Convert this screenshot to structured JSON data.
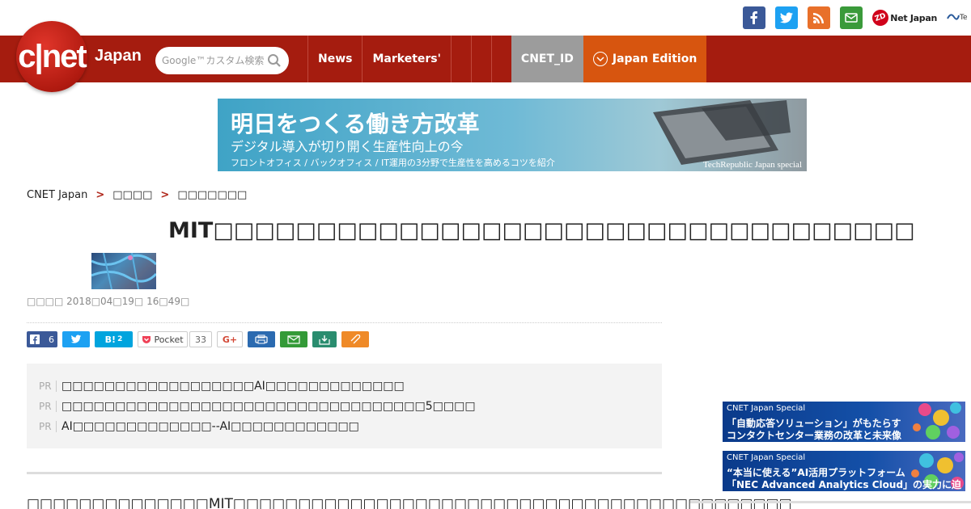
{
  "social": {
    "zdnet": "Net Japan",
    "zdnet_badge": "ZD",
    "techrepublic": "Te"
  },
  "header": {
    "logo_text": "c|net",
    "logo_sub": "Japan",
    "search_placeholder": "Google™カスタム検索",
    "nav": [
      "News",
      "Marketers'"
    ],
    "cnet_id": "CNET_ID",
    "edition": "Japan Edition"
  },
  "banner": {
    "line1": "明日をつくる働き方改革",
    "line2": "デジタル導入が切り開く生産性向上の今",
    "line3": "フロントオフィス / バックオフィス / IT運用の3分野で生産性を高めるコツを紹介",
    "line4": "TechRepublic Japan special"
  },
  "breadcrumb": [
    "CNET Japan",
    "□□□□",
    "□□□□□□□"
  ],
  "article": {
    "title": "MIT□□□□□□□□□□□□□□□□□□□□□□□□□□□□□□□□□□",
    "date": "□□□□ 2018□04□19□ 16□49□",
    "body": "□□□□□□□□□□□□□□MIT□□□□□□□□□□□□□□□□□□□□□□□□□□□□□□□□□□□□□□□□□□□"
  },
  "share": {
    "fb_count": "6",
    "hb_label": "B!",
    "hb_count": "2",
    "pocket": "Pocket",
    "pocket_count": "33",
    "gplus": "G+"
  },
  "pr": {
    "tag": "PR",
    "items": [
      "□□□□□□□□□□□□□□□□□□AI□□□□□□□□□□□□□",
      "□□□□□□□□□□□□□□□□□□□□□□□□□□□□□□□□□□5□□□□",
      "AI□□□□□□□□□□□□□--AI□□□□□□□□□□□□"
    ]
  },
  "sidebar": [
    {
      "head": "CNET Japan Special",
      "l1": "「自動応答ソリューション」がもたらす",
      "l2": "コンタクトセンター業務の改革と未来像"
    },
    {
      "head": "CNET Japan Special",
      "l1": "“本当に使える”AI活用プラットフォーム",
      "l2": "「NEC Advanced Analytics Cloud」の実力に迫る"
    }
  ],
  "colors": {
    "header_red": "#a51c0f",
    "cnet_id_gray": "#9c9c9c",
    "edition_orange": "#d7550f",
    "facebook": "#3b5998",
    "twitter": "#1da1f2",
    "rss": "#e8702a",
    "mail": "#3a9a3a"
  }
}
